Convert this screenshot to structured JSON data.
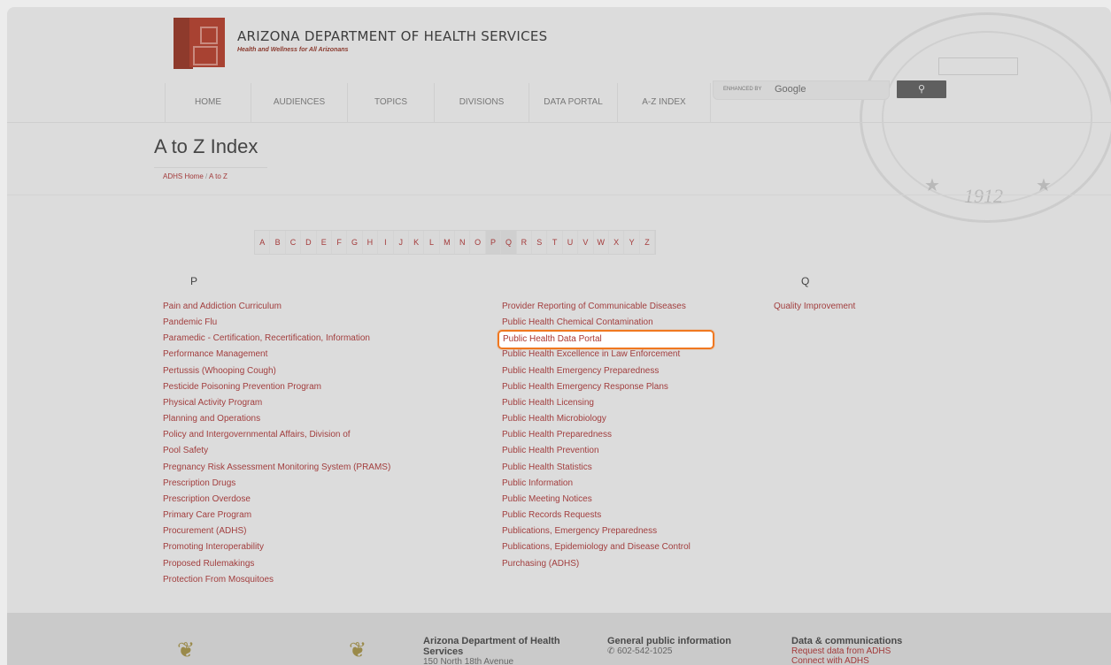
{
  "header": {
    "org_name": "ARIZONA DEPARTMENT OF HEALTH SERVICES",
    "tagline": "Health and Wellness for All Arizonans"
  },
  "nav": [
    "HOME",
    "AUDIENCES",
    "TOPICS",
    "DIVISIONS",
    "DATA PORTAL",
    "A-Z INDEX"
  ],
  "search": {
    "enhanced_by": "ENHANCED BY",
    "google": "Google",
    "button_icon": "search-icon"
  },
  "seal": {
    "year": "1912"
  },
  "page": {
    "title": "A to Z Index",
    "breadcrumb": [
      "ADHS Home",
      "A to Z"
    ],
    "breadcrumb_sep": "/"
  },
  "letters": [
    "A",
    "B",
    "C",
    "D",
    "E",
    "F",
    "G",
    "H",
    "I",
    "J",
    "K",
    "L",
    "M",
    "N",
    "O",
    "P",
    "Q",
    "R",
    "S",
    "T",
    "U",
    "V",
    "W",
    "X",
    "Y",
    "Z"
  ],
  "active_letters": [
    "P",
    "Q"
  ],
  "sections": {
    "p_heading": "P",
    "q_heading": "Q",
    "p_col1": [
      "Pain and Addiction Curriculum",
      "Pandemic Flu",
      "Paramedic - Certification, Recertification, Information",
      "Performance Management",
      "Pertussis (Whooping Cough)",
      "Pesticide Poisoning Prevention Program",
      "Physical Activity Program",
      "Planning and Operations",
      "Policy and Intergovernmental Affairs, Division of",
      "Pool Safety",
      "Pregnancy Risk Assessment Monitoring System (PRAMS)",
      "Prescription Drugs",
      "Prescription Overdose",
      "Primary Care Program",
      "Procurement (ADHS)",
      "Promoting Interoperability",
      "Proposed Rulemakings",
      "Protection From Mosquitoes"
    ],
    "p_col2": [
      "Provider Reporting of Communicable Diseases",
      "Public Health Chemical Contamination",
      "Public Health Data Portal",
      "Public Health Excellence in Law Enforcement",
      "Public Health Emergency Preparedness",
      "Public Health Emergency Response Plans",
      "Public Health Licensing",
      "Public Health Microbiology",
      "Public Health Preparedness",
      "Public Health Prevention",
      "Public Health Statistics",
      "Public Information",
      "Public Meeting Notices",
      "Public Records Requests",
      "Publications, Emergency Preparedness",
      "Publications, Epidemiology and Disease Control",
      "Purchasing (ADHS)"
    ],
    "q_col": [
      "Quality Improvement"
    ]
  },
  "highlighted_link": "Public Health Data Portal",
  "footer": {
    "org_title": "Arizona Department of Health",
    "org_title2": "Services",
    "org_address": "150 North 18th Avenue",
    "general_title": "General public information",
    "phone": "602-542-1025",
    "data_title": "Data & communications",
    "data_link1": "Request data from ADHS",
    "data_link2": "Connect with ADHS"
  },
  "colors": {
    "link": "#a23e3e",
    "highlight_border": "#f07820",
    "background": "#dcdcdc"
  }
}
